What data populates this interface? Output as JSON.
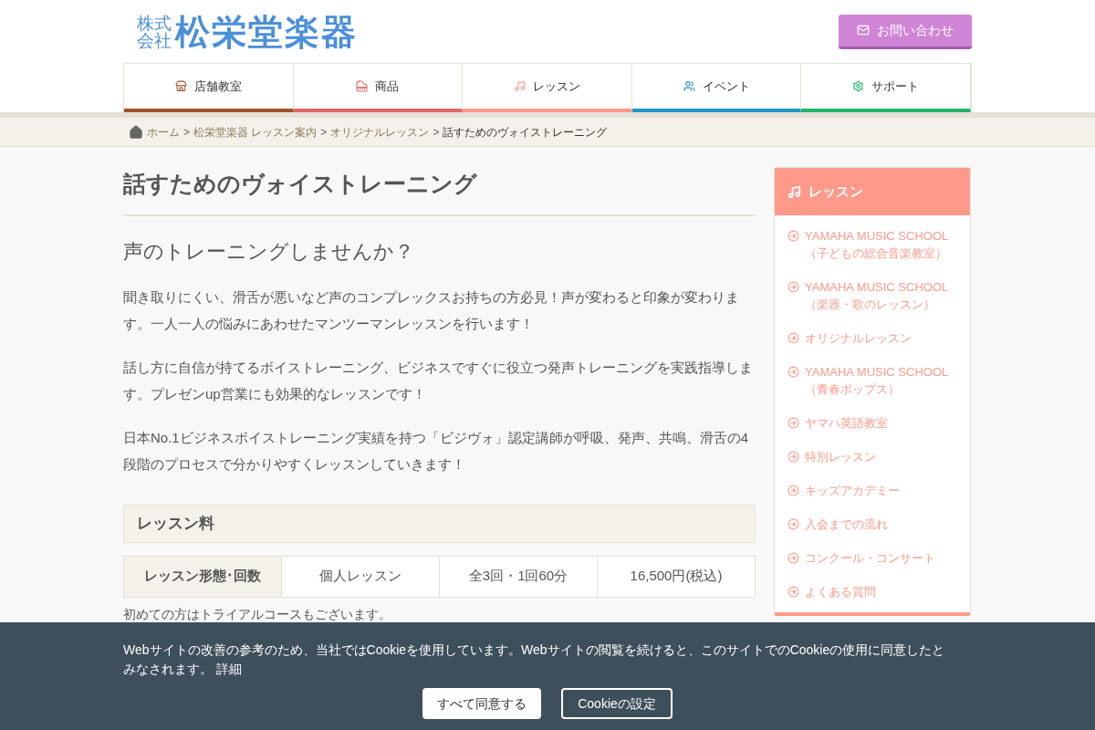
{
  "header": {
    "logo_small": [
      "株式",
      "会社"
    ],
    "logo_name": "松栄堂楽器",
    "contact_button": "お問い合わせ"
  },
  "nav": [
    {
      "label": "店舗教室",
      "color": "#a0522d"
    },
    {
      "label": "商品",
      "color": "#e06666"
    },
    {
      "label": "レッスン",
      "color": "#ff9a8b"
    },
    {
      "label": "イベント",
      "color": "#2196c9"
    },
    {
      "label": "サポート",
      "color": "#21b36b"
    }
  ],
  "breadcrumb": [
    {
      "kind": "link",
      "label": "ホーム"
    },
    {
      "kind": "separator",
      "label": ">"
    },
    {
      "kind": "link",
      "label": "松栄堂楽器 レッスン案内"
    },
    {
      "kind": "separator",
      "label": ">"
    },
    {
      "kind": "link",
      "label": "オリジナルレッスン"
    },
    {
      "kind": "separator",
      "label": ">"
    },
    {
      "kind": "current",
      "label": "話すためのヴォイストレーニング"
    }
  ],
  "main": {
    "title": "話すためのヴォイストレーニング",
    "subtitle": "声のトレーニングしませんか？",
    "paragraphs": [
      "聞き取りにくい、滑舌が悪いなど声のコンプレックスお持ちの方必見！声が変わると印象が変わります。一人一人の悩みにあわせたマンツーマンレッスンを行います！",
      "話し方に自信が持てるボイストレーニング、ビジネスですぐに役立つ発声トレーニングを実践指導します。プレゼンup営業にも効果的なレッスンです！",
      "日本No.1ビジネスボイストレーニング実績を持つ「ビジヴォ」認定講師が呼吸、発声、共鳴、滑舌の4段階のプロセスで分かりやすくレッスンしていきます！"
    ],
    "fee_heading": "レッスン料",
    "fee_table": [
      "レッスン形態･回数",
      "個人レッスン",
      "全3回・1回60分",
      "16,500円(税込)"
    ],
    "note": "初めての方はトライアルコースもございます。"
  },
  "sidebar": {
    "title": "レッスン",
    "items": [
      {
        "label": "YAMAHA MUSIC SCHOOL",
        "sub": "（子どもの総合音楽教室）"
      },
      {
        "label": "YAMAHA MUSIC SCHOOL",
        "sub": "（楽器・歌のレッスン）"
      },
      {
        "label": "オリジナルレッスン"
      },
      {
        "label": "YAMAHA MUSIC SCHOOL",
        "sub": "（青春ポップス）"
      },
      {
        "label": "ヤマハ英語教室"
      },
      {
        "label": "特別レッスン"
      },
      {
        "label": "キッズアカデミー"
      },
      {
        "label": "入会までの流れ"
      },
      {
        "label": "コンクール・コンサート"
      },
      {
        "label": "よくある質問"
      }
    ]
  },
  "cookie_banner": {
    "message": "Webサイトの改善の参考のため、当社ではCookieを使用しています。Webサイトの閲覧を続けると、このサイトでのCookieの使用に同意したとみなされます。",
    "details_link": "詳細",
    "accept_button": "すべて同意する",
    "settings_button": "Cookieの設定"
  }
}
